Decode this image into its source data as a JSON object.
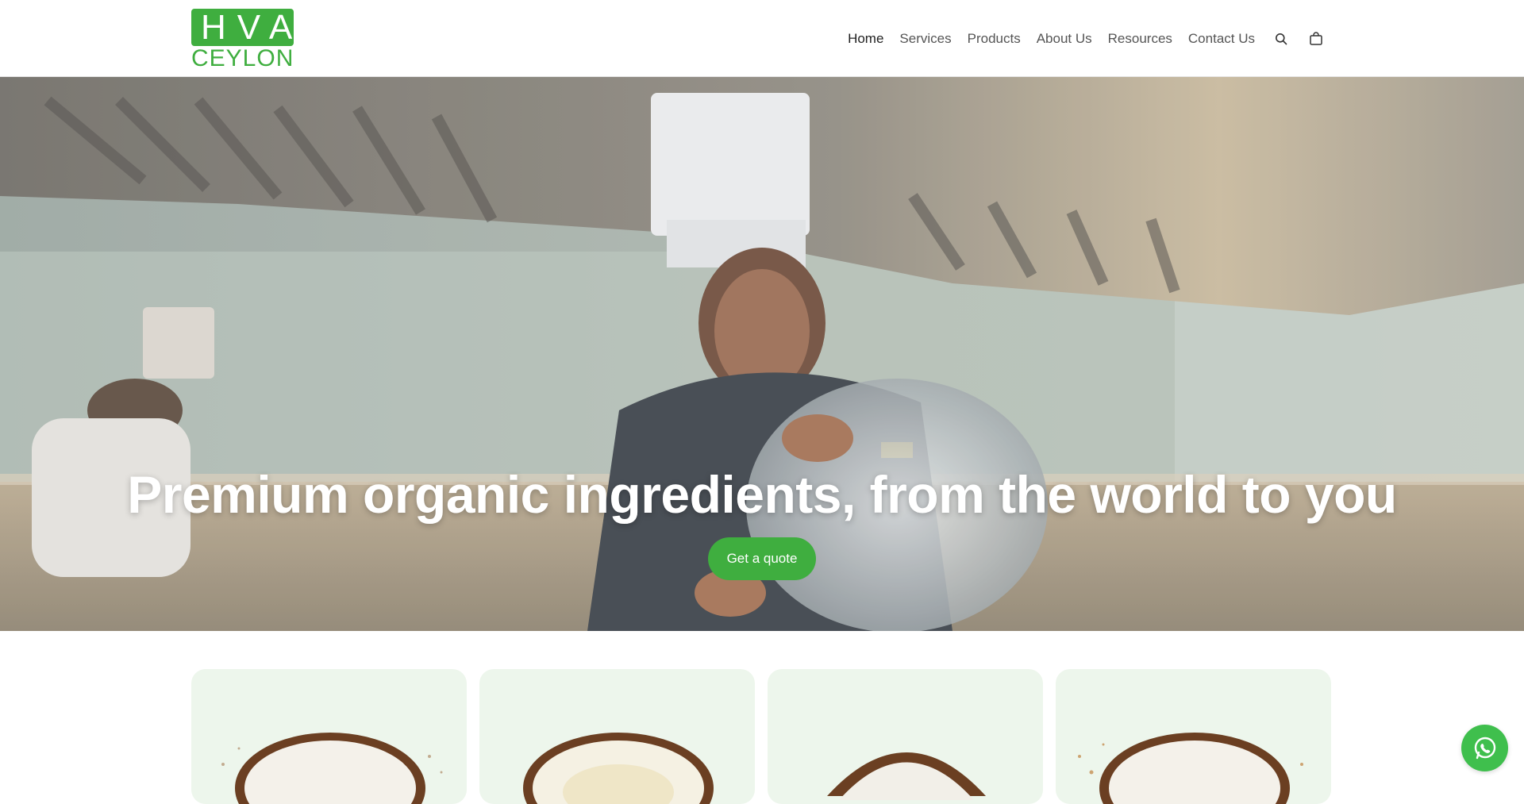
{
  "brand": {
    "logo_top": "HVA",
    "logo_bottom": "CEYLON",
    "color": "#3fae3f"
  },
  "nav": {
    "items": [
      {
        "label": "Home",
        "active": true
      },
      {
        "label": "Services"
      },
      {
        "label": "Products"
      },
      {
        "label": "About Us"
      },
      {
        "label": "Resources"
      },
      {
        "label": "Contact Us"
      }
    ],
    "search_icon": "search-icon",
    "cart_icon": "shopping-bag-icon"
  },
  "hero": {
    "title": "Premium organic ingredients, from the world to you",
    "cta_label": "Get a quote"
  },
  "cards": [
    {
      "image": "coconut-half"
    },
    {
      "image": "coconut-half"
    },
    {
      "image": "coconut-half"
    },
    {
      "image": "coconut-half"
    }
  ],
  "whatsapp": {
    "icon": "whatsapp-icon",
    "color": "#3fbf4d"
  }
}
